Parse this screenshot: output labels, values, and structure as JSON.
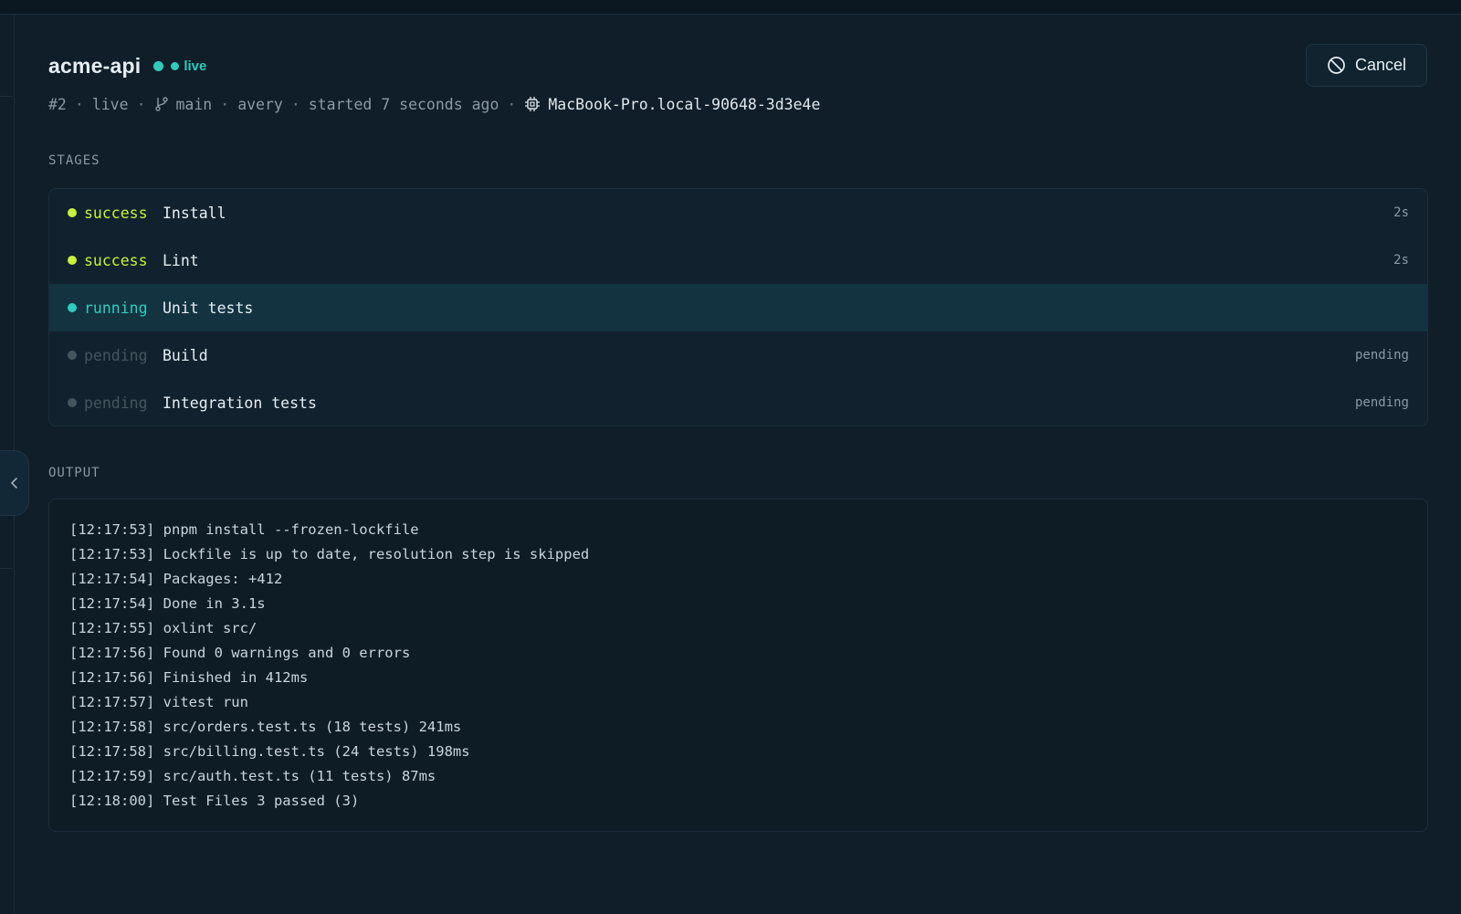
{
  "header": {
    "app_name": "acme-api",
    "status_label": "live"
  },
  "meta": {
    "run_number": "#2",
    "status": "live",
    "branch": "main",
    "user": "avery",
    "started": "started 7 seconds ago",
    "host": "MacBook-Pro.local-90648-3d3e4e"
  },
  "actions": {
    "cancel_label": "Cancel"
  },
  "stages": {
    "title": "STAGES",
    "items": [
      {
        "status": "success",
        "name": "Install",
        "duration": "2s"
      },
      {
        "status": "success",
        "name": "Lint",
        "duration": "2s"
      },
      {
        "status": "running",
        "name": "Unit tests",
        "duration": ""
      },
      {
        "status": "pending",
        "name": "Build",
        "duration": "pending"
      },
      {
        "status": "pending",
        "name": "Integration tests",
        "duration": "pending"
      }
    ]
  },
  "output": {
    "title": "OUTPUT",
    "lines": [
      "[12:17:53] pnpm install --frozen-lockfile",
      "[12:17:53] Lockfile is up to date, resolution step is skipped",
      "[12:17:54] Packages: +412",
      "[12:17:54] Done in 3.1s",
      "[12:17:55] oxlint src/",
      "[12:17:56] Found 0 warnings and 0 errors",
      "[12:17:56] Finished in 412ms",
      "[12:17:57] vitest run",
      "[12:17:58] src/orders.test.ts (18 tests) 241ms",
      "[12:17:58] src/billing.test.ts (24 tests) 198ms",
      "[12:17:59] src/auth.test.ts (11 tests) 87ms",
      "[12:18:00] Test Files 3 passed (3)"
    ]
  },
  "colors": {
    "success": "#c8f03c",
    "running": "#2fcbbd",
    "pending": "#46545e",
    "background": "#0f1e29"
  }
}
